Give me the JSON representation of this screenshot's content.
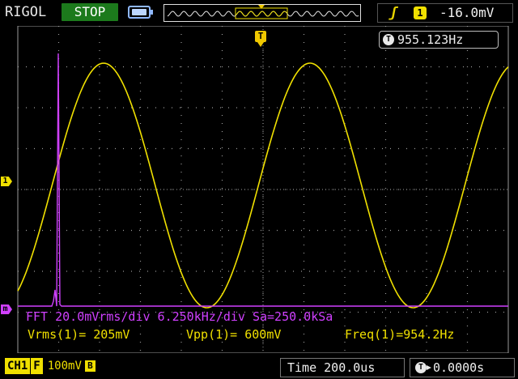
{
  "header": {
    "brand": "RIGOL",
    "run_state": "STOP",
    "trigger": {
      "edge": "rising-edge-icon",
      "source_channel": "1",
      "level": "-16.0mV"
    }
  },
  "display": {
    "frequency_counter": "955.123Hz",
    "trigger_position_marker": "T",
    "ch1_level_marker": "1",
    "math_marker": "m",
    "fft_status": "FFT 20.0mVrms/div 6.250kHz/div Sa=250.0kSa",
    "measurements": [
      {
        "label": "Vrms(1)=",
        "value": "205mV"
      },
      {
        "label": "Vpp(1)=",
        "value": "600mV"
      },
      {
        "label": "Freq(1)=",
        "value": "954.2Hz"
      }
    ]
  },
  "footer": {
    "channel": "CH1",
    "coupling": "F",
    "scale": "100mV",
    "bandwidth_limit": "B",
    "timebase_label": "Time",
    "timebase_value": "200.0us",
    "trigger_offset": "0.0000s"
  },
  "colors": {
    "ch1": "#f0e000",
    "math": "#d040ff",
    "grid": "#9a9a9a",
    "run_state_bg": "#1c7a1c"
  }
}
